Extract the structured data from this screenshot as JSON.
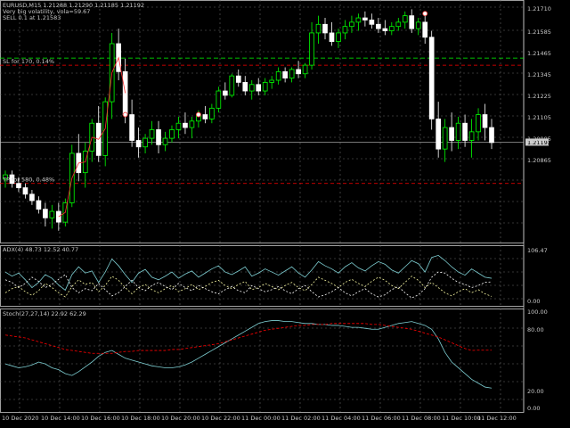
{
  "header": {
    "symbol_line": "EURUSD,M15  1.21288 1.21290 1.21185 1.21192",
    "volatility_line": "Very big volatility, vola=59.67",
    "order_line": "SELL 0.1 at 1.21583"
  },
  "levels": {
    "sl_label": "SL for 170, 0.14%",
    "tp_label": "TP for 580, 0.48%",
    "current_price_label": "1.21192"
  },
  "colors": {
    "background": "#000000",
    "grid": "#666666",
    "bull_candle": "#00ff00",
    "bear_candle": "#ffffff",
    "sl_line": "#ff0000",
    "tp_line": "#ff0000",
    "entry_line": "#00ff00",
    "adx_main": "#7ecfd3",
    "adx_plus": "#f5f5a0",
    "adx_minus": "#ffffff",
    "stoch_main": "#7ecfd3",
    "stoch_signal": "#ff0000"
  },
  "price_axis": {
    "ticks": [
      "1.21710",
      "1.21585",
      "1.21465",
      "1.21345",
      "1.21225",
      "1.21105",
      "1.20985",
      "1.20865"
    ]
  },
  "time_axis": {
    "ticks": [
      "10 Dec 2020",
      "10 Dec 14:00",
      "10 Dec 16:00",
      "10 Dec 18:00",
      "10 Dec 20:00",
      "10 Dec 22:00",
      "11 Dec 00:00",
      "11 Dec 02:00",
      "11 Dec 04:00",
      "11 Dec 06:00",
      "11 Dec 08:00",
      "11 Dec 10:00",
      "11 Dec 12:00"
    ]
  },
  "adx_panel": {
    "label": "ADX(4) 48.73 12.52 40.77",
    "ticks": [
      "106.47",
      "0.00"
    ]
  },
  "stoch_panel": {
    "label": "Stoch(27,27,14) 22.92 62.29",
    "ticks": [
      "100.00",
      "80.00",
      "20.00",
      "0.00"
    ]
  },
  "chart_data": {
    "type": "candlestick",
    "symbol": "EURUSD",
    "timeframe": "M15",
    "ylim": [
      1.2075,
      1.2182
    ],
    "sl_level": 1.2155,
    "tp_level": 1.21,
    "entry_level": 1.21583,
    "current_price": 1.21192,
    "candles": [
      {
        "o": 1.2102,
        "h": 1.2106,
        "l": 1.2098,
        "c": 1.2104
      },
      {
        "o": 1.2104,
        "h": 1.2106,
        "l": 1.2098,
        "c": 1.21
      },
      {
        "o": 1.21,
        "h": 1.2103,
        "l": 1.2096,
        "c": 1.2098
      },
      {
        "o": 1.2098,
        "h": 1.21,
        "l": 1.2093,
        "c": 1.2095
      },
      {
        "o": 1.2095,
        "h": 1.2097,
        "l": 1.209,
        "c": 1.2092
      },
      {
        "o": 1.2092,
        "h": 1.2094,
        "l": 1.2086,
        "c": 1.2088
      },
      {
        "o": 1.2088,
        "h": 1.2091,
        "l": 1.208,
        "c": 1.2084
      },
      {
        "o": 1.2084,
        "h": 1.209,
        "l": 1.2079,
        "c": 1.2087
      },
      {
        "o": 1.2087,
        "h": 1.2091,
        "l": 1.2078,
        "c": 1.2082
      },
      {
        "o": 1.2082,
        "h": 1.2093,
        "l": 1.208,
        "c": 1.2091
      },
      {
        "o": 1.2091,
        "h": 1.2118,
        "l": 1.2089,
        "c": 1.2114
      },
      {
        "o": 1.2114,
        "h": 1.2123,
        "l": 1.2101,
        "c": 1.2105
      },
      {
        "o": 1.2105,
        "h": 1.2119,
        "l": 1.2098,
        "c": 1.2115
      },
      {
        "o": 1.2115,
        "h": 1.213,
        "l": 1.211,
        "c": 1.2128
      },
      {
        "o": 1.2128,
        "h": 1.2136,
        "l": 1.211,
        "c": 1.2113
      },
      {
        "o": 1.2113,
        "h": 1.214,
        "l": 1.2108,
        "c": 1.2138
      },
      {
        "o": 1.2138,
        "h": 1.217,
        "l": 1.213,
        "c": 1.2165
      },
      {
        "o": 1.2165,
        "h": 1.2172,
        "l": 1.2148,
        "c": 1.2152
      },
      {
        "o": 1.2152,
        "h": 1.2158,
        "l": 1.2128,
        "c": 1.2132
      },
      {
        "o": 1.2132,
        "h": 1.2139,
        "l": 1.2117,
        "c": 1.212
      },
      {
        "o": 1.212,
        "h": 1.2126,
        "l": 1.2112,
        "c": 1.2117
      },
      {
        "o": 1.2117,
        "h": 1.2123,
        "l": 1.2114,
        "c": 1.2121
      },
      {
        "o": 1.2121,
        "h": 1.2129,
        "l": 1.2118,
        "c": 1.2125
      },
      {
        "o": 1.2125,
        "h": 1.2129,
        "l": 1.2114,
        "c": 1.2118
      },
      {
        "o": 1.2118,
        "h": 1.2124,
        "l": 1.2115,
        "c": 1.2121
      },
      {
        "o": 1.2121,
        "h": 1.2127,
        "l": 1.2119,
        "c": 1.2125
      },
      {
        "o": 1.2125,
        "h": 1.2131,
        "l": 1.2121,
        "c": 1.2128
      },
      {
        "o": 1.2128,
        "h": 1.2133,
        "l": 1.2123,
        "c": 1.2126
      },
      {
        "o": 1.2126,
        "h": 1.2131,
        "l": 1.2121,
        "c": 1.2129
      },
      {
        "o": 1.2129,
        "h": 1.2134,
        "l": 1.2126,
        "c": 1.2132
      },
      {
        "o": 1.2132,
        "h": 1.2136,
        "l": 1.2128,
        "c": 1.213
      },
      {
        "o": 1.213,
        "h": 1.2137,
        "l": 1.2128,
        "c": 1.2135
      },
      {
        "o": 1.2135,
        "h": 1.2145,
        "l": 1.2133,
        "c": 1.2143
      },
      {
        "o": 1.2143,
        "h": 1.2147,
        "l": 1.2139,
        "c": 1.2141
      },
      {
        "o": 1.2141,
        "h": 1.2151,
        "l": 1.214,
        "c": 1.215
      },
      {
        "o": 1.215,
        "h": 1.2153,
        "l": 1.2145,
        "c": 1.2147
      },
      {
        "o": 1.2147,
        "h": 1.215,
        "l": 1.2141,
        "c": 1.2143
      },
      {
        "o": 1.2143,
        "h": 1.2148,
        "l": 1.2139,
        "c": 1.2146
      },
      {
        "o": 1.2146,
        "h": 1.2149,
        "l": 1.2141,
        "c": 1.2143
      },
      {
        "o": 1.2143,
        "h": 1.2149,
        "l": 1.2141,
        "c": 1.2147
      },
      {
        "o": 1.2147,
        "h": 1.215,
        "l": 1.2144,
        "c": 1.2148
      },
      {
        "o": 1.2148,
        "h": 1.2154,
        "l": 1.2146,
        "c": 1.2152
      },
      {
        "o": 1.2152,
        "h": 1.2154,
        "l": 1.2147,
        "c": 1.2149
      },
      {
        "o": 1.2149,
        "h": 1.2154,
        "l": 1.2147,
        "c": 1.2153
      },
      {
        "o": 1.2153,
        "h": 1.2157,
        "l": 1.2149,
        "c": 1.2151
      },
      {
        "o": 1.2151,
        "h": 1.2156,
        "l": 1.2149,
        "c": 1.2155
      },
      {
        "o": 1.2155,
        "h": 1.2175,
        "l": 1.2153,
        "c": 1.217
      },
      {
        "o": 1.217,
        "h": 1.2178,
        "l": 1.2165,
        "c": 1.2174
      },
      {
        "o": 1.2174,
        "h": 1.2177,
        "l": 1.2167,
        "c": 1.217
      },
      {
        "o": 1.217,
        "h": 1.2175,
        "l": 1.2164,
        "c": 1.2166
      },
      {
        "o": 1.2166,
        "h": 1.2172,
        "l": 1.2163,
        "c": 1.217
      },
      {
        "o": 1.217,
        "h": 1.2176,
        "l": 1.2167,
        "c": 1.2173
      },
      {
        "o": 1.2173,
        "h": 1.2178,
        "l": 1.217,
        "c": 1.2175
      },
      {
        "o": 1.2175,
        "h": 1.2179,
        "l": 1.2171,
        "c": 1.2177
      },
      {
        "o": 1.2177,
        "h": 1.218,
        "l": 1.2173,
        "c": 1.2176
      },
      {
        "o": 1.2176,
        "h": 1.2179,
        "l": 1.2172,
        "c": 1.2174
      },
      {
        "o": 1.2174,
        "h": 1.2177,
        "l": 1.217,
        "c": 1.2172
      },
      {
        "o": 1.2172,
        "h": 1.2176,
        "l": 1.2169,
        "c": 1.2171
      },
      {
        "o": 1.2171,
        "h": 1.2175,
        "l": 1.2169,
        "c": 1.2173
      },
      {
        "o": 1.2173,
        "h": 1.2177,
        "l": 1.2171,
        "c": 1.2175
      },
      {
        "o": 1.2175,
        "h": 1.218,
        "l": 1.2172,
        "c": 1.2178
      },
      {
        "o": 1.2178,
        "h": 1.2181,
        "l": 1.217,
        "c": 1.2172
      },
      {
        "o": 1.2172,
        "h": 1.2177,
        "l": 1.2169,
        "c": 1.2175
      },
      {
        "o": 1.2175,
        "h": 1.2178,
        "l": 1.2165,
        "c": 1.2168
      },
      {
        "o": 1.2168,
        "h": 1.2171,
        "l": 1.2125,
        "c": 1.213
      },
      {
        "o": 1.213,
        "h": 1.2138,
        "l": 1.2112,
        "c": 1.2116
      },
      {
        "o": 1.2116,
        "h": 1.213,
        "l": 1.211,
        "c": 1.2126
      },
      {
        "o": 1.2126,
        "h": 1.2133,
        "l": 1.2115,
        "c": 1.212
      },
      {
        "o": 1.212,
        "h": 1.2131,
        "l": 1.2116,
        "c": 1.2128
      },
      {
        "o": 1.2128,
        "h": 1.2132,
        "l": 1.2117,
        "c": 1.212
      },
      {
        "o": 1.212,
        "h": 1.213,
        "l": 1.2112,
        "c": 1.2124
      },
      {
        "o": 1.2124,
        "h": 1.2135,
        "l": 1.212,
        "c": 1.2132
      },
      {
        "o": 1.2132,
        "h": 1.2137,
        "l": 1.212,
        "c": 1.2126
      },
      {
        "o": 1.2126,
        "h": 1.213,
        "l": 1.2116,
        "c": 1.2119
      }
    ],
    "adx": {
      "name": "ADX(4)",
      "ylim": [
        0,
        106.47
      ],
      "main": [
        60,
        52,
        58,
        45,
        30,
        40,
        55,
        48,
        35,
        25,
        55,
        70,
        58,
        62,
        40,
        60,
        85,
        72,
        55,
        40,
        58,
        65,
        50,
        45,
        52,
        60,
        48,
        56,
        62,
        50,
        58,
        66,
        72,
        60,
        55,
        62,
        70,
        52,
        58,
        66,
        60,
        54,
        62,
        70,
        58,
        50,
        64,
        80,
        72,
        66,
        58,
        70,
        78,
        68,
        62,
        72,
        80,
        75,
        64,
        58,
        70,
        82,
        76,
        60,
        88,
        92,
        82,
        70,
        60,
        54,
        66,
        58,
        50,
        48
      ],
      "plus_di": [
        20,
        28,
        32,
        22,
        15,
        24,
        38,
        30,
        20,
        12,
        32,
        45,
        36,
        40,
        22,
        34,
        52,
        44,
        30,
        18,
        30,
        36,
        26,
        20,
        28,
        34,
        22,
        28,
        36,
        26,
        32,
        40,
        44,
        34,
        28,
        36,
        42,
        26,
        30,
        38,
        32,
        26,
        34,
        40,
        30,
        24,
        36,
        50,
        44,
        38,
        30,
        40,
        46,
        38,
        32,
        42,
        50,
        44,
        34,
        28,
        40,
        52,
        44,
        30,
        40,
        30,
        20,
        14,
        22,
        28,
        20,
        26,
        18,
        13
      ],
      "minus_di": [
        45,
        40,
        30,
        38,
        50,
        42,
        30,
        36,
        46,
        55,
        30,
        20,
        28,
        24,
        38,
        26,
        14,
        20,
        32,
        44,
        30,
        24,
        34,
        40,
        32,
        26,
        38,
        30,
        24,
        34,
        28,
        22,
        18,
        26,
        32,
        24,
        20,
        34,
        28,
        22,
        26,
        32,
        24,
        18,
        28,
        34,
        22,
        12,
        16,
        22,
        30,
        20,
        14,
        22,
        28,
        18,
        12,
        16,
        26,
        32,
        20,
        10,
        16,
        28,
        50,
        60,
        58,
        48,
        40,
        36,
        30,
        34,
        40,
        41
      ]
    },
    "stochastic": {
      "name": "Stoch(27,27,14)",
      "ylim": [
        0,
        100
      ],
      "main": [
        48,
        46,
        44,
        45,
        47,
        50,
        48,
        44,
        42,
        38,
        36,
        40,
        45,
        50,
        56,
        60,
        62,
        58,
        54,
        52,
        50,
        48,
        46,
        45,
        44,
        44,
        45,
        47,
        50,
        54,
        58,
        62,
        66,
        70,
        74,
        78,
        82,
        86,
        90,
        92,
        93,
        93,
        92,
        92,
        91,
        90,
        90,
        89,
        89,
        88,
        88,
        87,
        86,
        86,
        85,
        84,
        84,
        86,
        88,
        90,
        91,
        92,
        90,
        88,
        84,
        74,
        60,
        50,
        44,
        38,
        32,
        28,
        24,
        22.9
      ],
      "signal": [
        78,
        77,
        76,
        75,
        73,
        71,
        69,
        67,
        65,
        63,
        62,
        61,
        60,
        59,
        59,
        59,
        59,
        60,
        61,
        61,
        62,
        62,
        62,
        62,
        62,
        63,
        63,
        64,
        65,
        66,
        67,
        68,
        69,
        71,
        73,
        75,
        77,
        79,
        81,
        83,
        84,
        85,
        86,
        87,
        88,
        88,
        89,
        89,
        89,
        90,
        90,
        90,
        90,
        90,
        90,
        89,
        89,
        88,
        87,
        86,
        85,
        84,
        82,
        80,
        78,
        76,
        73,
        70,
        67,
        64,
        62,
        62.3,
        62.3,
        62.29
      ]
    }
  }
}
